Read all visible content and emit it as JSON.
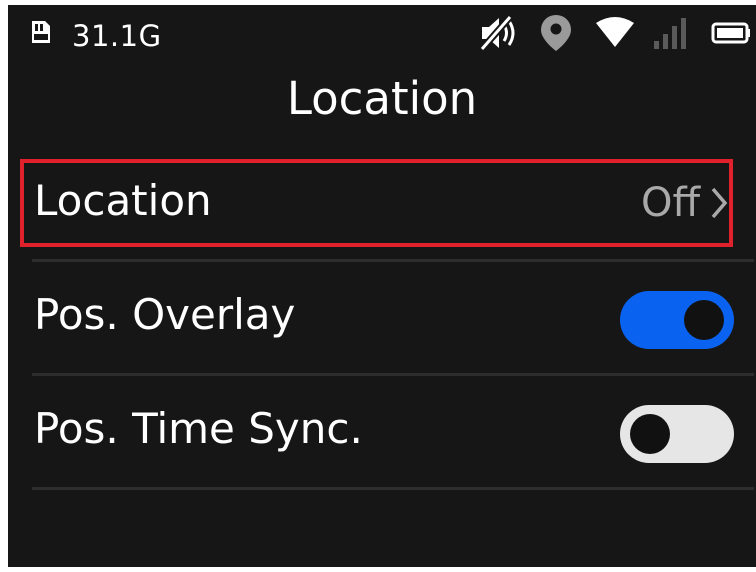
{
  "status_bar": {
    "storage_text": "31.1G",
    "icons": [
      "sd-card-icon",
      "mute-icon",
      "location-pin-icon",
      "wifi-icon",
      "cellular-signal-icon",
      "battery-icon"
    ]
  },
  "page": {
    "title": "Location"
  },
  "settings": {
    "location": {
      "label": "Location",
      "value": "Off",
      "highlighted": true,
      "highlight_color": "#e0202a"
    },
    "pos_overlay": {
      "label": "Pos. Overlay",
      "enabled": true,
      "toggle_color": "#0a63f0"
    },
    "pos_time_sync": {
      "label": "Pos. Time Sync.",
      "enabled": false,
      "toggle_color": "#e6e6e6"
    }
  }
}
